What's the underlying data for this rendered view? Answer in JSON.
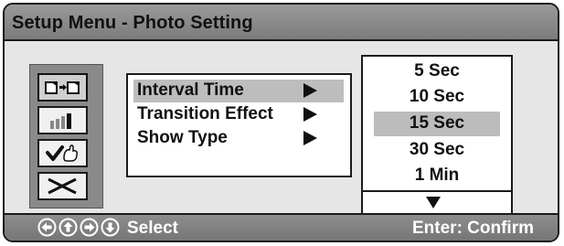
{
  "window": {
    "title": "Setup Menu - Photo Setting"
  },
  "sidebar": {
    "icons": [
      {
        "name": "photo-transition-icon",
        "selected": true
      },
      {
        "name": "bar-levels-icon",
        "selected": false
      },
      {
        "name": "checkmark-hand-icon",
        "selected": false
      },
      {
        "name": "close-x-icon",
        "selected": false
      }
    ]
  },
  "submenu": {
    "items": [
      {
        "label": "Interval Time",
        "highlighted": true
      },
      {
        "label": "Transition Effect",
        "highlighted": false
      },
      {
        "label": "Show Type",
        "highlighted": false
      }
    ]
  },
  "options": {
    "items": [
      {
        "label": "5 Sec",
        "selected": false
      },
      {
        "label": "10 Sec",
        "selected": false
      },
      {
        "label": "15 Sec",
        "selected": true
      },
      {
        "label": "30 Sec",
        "selected": false
      },
      {
        "label": "1 Min",
        "selected": false
      }
    ],
    "more_indicator": "scroll-down-arrow-icon"
  },
  "footer": {
    "nav_icons": [
      "left-arrow-icon",
      "up-arrow-icon",
      "right-arrow-icon",
      "down-arrow-icon"
    ],
    "select_label": "Select",
    "confirm_label": "Enter: Confirm"
  },
  "colors": {
    "titlebar": "#8a8a8a",
    "panel_bg": "#e6e6e6",
    "highlight": "#bdbdbd",
    "footer_text": "#ffffff"
  }
}
